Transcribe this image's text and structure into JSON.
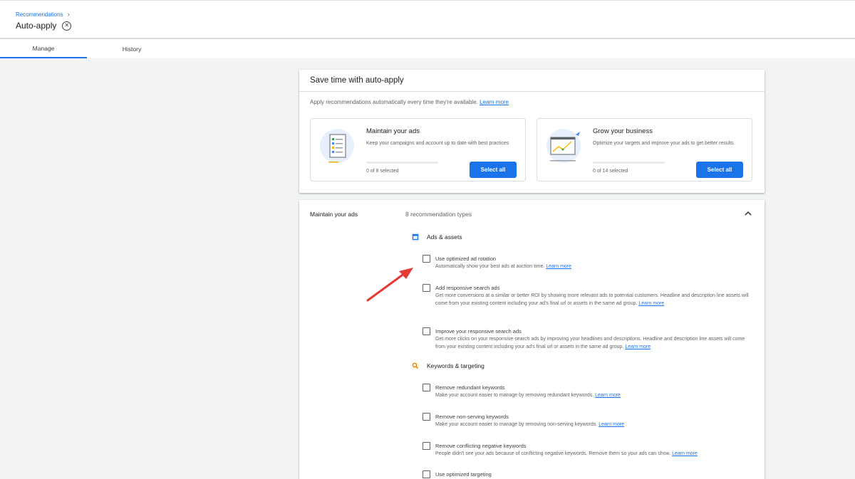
{
  "breadcrumb": {
    "label": "Recommendations"
  },
  "page": {
    "title": "Auto-apply"
  },
  "tabs": [
    {
      "label": "Manage"
    },
    {
      "label": "History"
    }
  ],
  "summary_card": {
    "title": "Save time with auto-apply",
    "subtitle": "Apply recommendations automatically every time they're available.",
    "learn_more": "Learn more",
    "panels": [
      {
        "title": "Maintain your ads",
        "description": "Keep your campaigns and account up to date with best practices",
        "selected": "0 of 8 selected",
        "button": "Select all",
        "progress_fraction": 0
      },
      {
        "title": "Grow your business",
        "description": "Optimize your targets and improve your ads to get better results",
        "selected": "0 of 14 selected",
        "button": "Select all",
        "progress_fraction": 0
      }
    ]
  },
  "maintain_card": {
    "label": "Maintain your ads",
    "count": "8 recommendation types",
    "groups": [
      {
        "title": "Ads & assets",
        "items": [
          {
            "title": "Use optimized ad rotation",
            "description": "Automatically show your best ads at auction time.",
            "link": "Learn more",
            "checked": false
          },
          {
            "title": "Add responsive search ads",
            "description": "Get more conversions at a similar or better ROI by showing more relevant ads to potential customers. Headline and description line assets will come from your existing content including your ad's final url or assets in the same ad group.",
            "link": "Learn more",
            "checked": false
          },
          {
            "title": "Improve your responsive search ads",
            "description": "Get more clicks on your responsive search ads by improving your headlines and descriptions. Headline and description line assets will come from your existing content including your ad's final url or assets in the same ad group.",
            "link": "Learn more",
            "checked": false
          }
        ]
      },
      {
        "title": "Keywords & targeting",
        "items": [
          {
            "title": "Remove redundant keywords",
            "description": "Make your account easier to manage by removing redundant keywords.",
            "link": "Learn more",
            "checked": false
          },
          {
            "title": "Remove non-serving keywords",
            "description": "Make your account easier to manage by removing non-serving keywords.",
            "link": "Learn more",
            "checked": false
          },
          {
            "title": "Remove conflicting negative keywords",
            "description": "People didn't see your ads because of conflicting negative keywords. Remove them so your ads can show.",
            "link": "Learn more",
            "checked": false
          },
          {
            "title": "Use optimized targeting",
            "description": "",
            "link": "",
            "checked": false
          }
        ]
      }
    ]
  },
  "colors": {
    "accent": "#1a73e8",
    "annotation_arrow": "#e53935",
    "background": "#f1f3f4"
  },
  "icons": [
    "chevron-right-icon",
    "close-circle-icon",
    "chevron-up-icon",
    "ads-assets-icon",
    "search-icon",
    "red-arrow-annotation"
  ]
}
